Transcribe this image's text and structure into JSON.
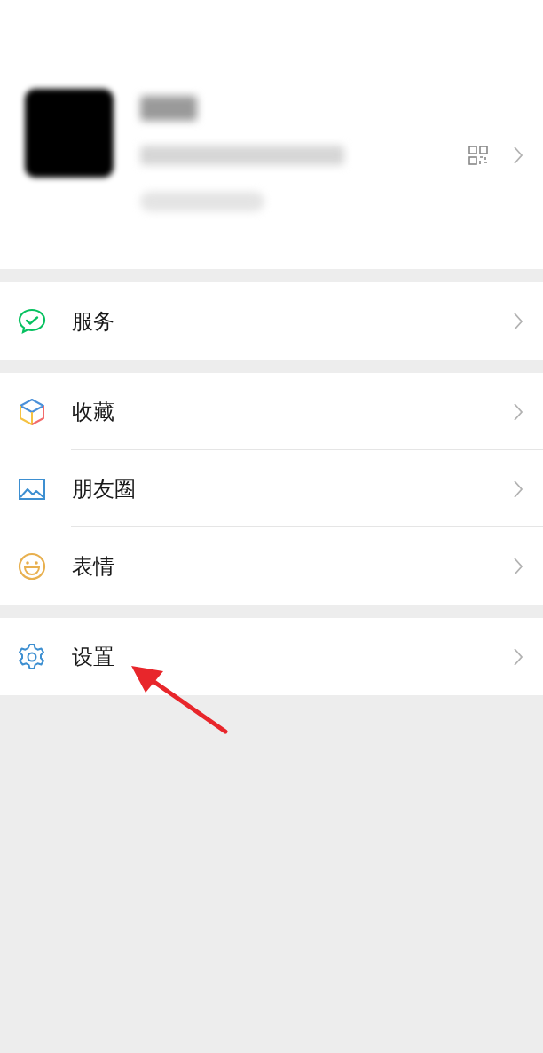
{
  "menu_groups": [
    {
      "items": [
        {
          "label": "服务",
          "kind": "service"
        }
      ]
    },
    {
      "items": [
        {
          "label": "收藏",
          "kind": "favorites"
        },
        {
          "label": "朋友圈",
          "kind": "moments"
        },
        {
          "label": "表情",
          "kind": "stickers"
        }
      ]
    },
    {
      "items": [
        {
          "label": "设置",
          "kind": "settings"
        }
      ]
    }
  ],
  "pointer_arrow": true
}
